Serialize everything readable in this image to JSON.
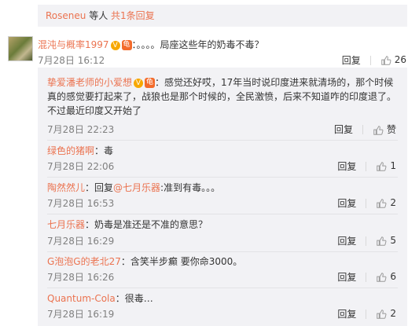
{
  "top": {
    "user": "Roseneu",
    "text1": " 等人 ",
    "count_link": "共1条回复"
  },
  "main_comment": {
    "user": "混沌与概率1997",
    "text": "：。。。。局座这些年的奶毒不毒？",
    "time": "7月28日 16:12",
    "reply_label": "回复",
    "likes": "26"
  },
  "replies": [
    {
      "user": "挚爱潘老师的小爱想",
      "text_line1": "：感觉还好哎，17年当时说印度进来就清场的，那个时候",
      "text_line2": "真的感觉要打起来了，战狼也是那个时候的，全民激愤，后来不知道咋的印度退了。",
      "text_line3": "不过最近印度又开始了",
      "time": "7月28日 22:23",
      "reply_label": "回复",
      "likes": "赞"
    },
    {
      "user": "绿色的猪啊",
      "text": "：毒",
      "time": "7月28日 22:06",
      "reply_label": "回复",
      "likes": "1"
    },
    {
      "user": "陶然然儿",
      "text_prefix": "：回复",
      "mention": "@七月乐器",
      "text": ":准到有毒。。。",
      "time": "7月28日 16:53",
      "reply_label": "回复",
      "likes": "2"
    },
    {
      "user": "七月乐器",
      "text": "：奶毒是准还是不准的意思？",
      "time": "7月28日 16:29",
      "reply_label": "回复",
      "likes": "5"
    },
    {
      "user": "G泡泡G的老北27",
      "text": "：含笑半步癫 要你命3000。",
      "time": "7月28日 16:26",
      "reply_label": "回复",
      "likes": "6"
    },
    {
      "user": "Quantum-Cola",
      "text": "：很毒…",
      "time": "7月28日 16:19",
      "reply_label": "回复",
      "likes": "2"
    }
  ],
  "badges": {
    "v": "V",
    "r": "龟"
  }
}
